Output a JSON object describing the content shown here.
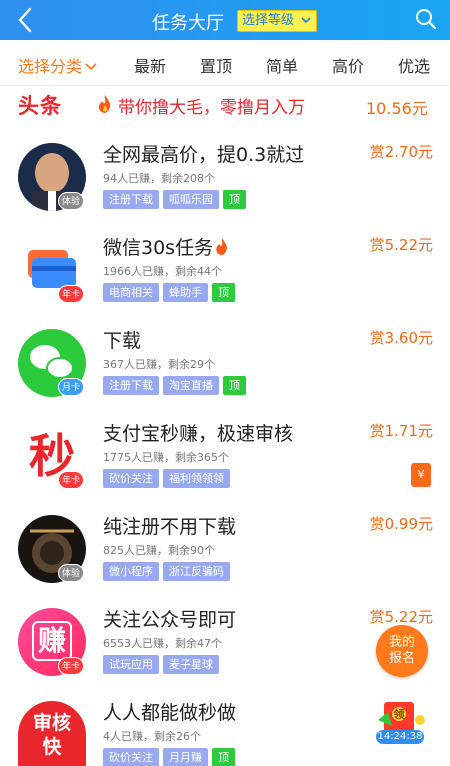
{
  "header": {
    "title": "任务大厅",
    "level_button": "选择等级"
  },
  "filters": {
    "category": "选择分类",
    "items": [
      "最新",
      "置顶",
      "简单",
      "高价",
      "优选"
    ]
  },
  "news": {
    "logo": "头条",
    "text": "带你撸大毛，零撸月入万",
    "amount": "10.56元"
  },
  "tasks": [
    {
      "title": "全网最高价，提0.3就过",
      "meta": "94人已赚，剩余208个",
      "tags": [
        "注册下载",
        "呱呱乐园"
      ],
      "top": "顶",
      "reward": "赏2.70元",
      "badge": "体验",
      "avatar": "portrait"
    },
    {
      "title": "微信30s任务",
      "meta": "1966人已赚，剩余44个",
      "tags": [
        "电商相关",
        "蜂助手"
      ],
      "top": "顶",
      "reward": "赏5.22元",
      "badge": "年卡",
      "avatar": "card"
    },
    {
      "title": "下载",
      "meta": "367人已赚，剩余29个",
      "tags": [
        "注册下载",
        "淘宝直播"
      ],
      "top": "顶",
      "reward": "赏3.60元",
      "badge": "月卡",
      "avatar": "wechat"
    },
    {
      "title": "支付宝秒赚，极速审核",
      "meta": "1775人已赚，剩余365个",
      "tags": [
        "砍价关注",
        "福利领领领"
      ],
      "top": "",
      "reward": "赏1.71元",
      "badge": "年卡",
      "avatar": "秒"
    },
    {
      "title": "纯注册不用下载",
      "meta": "825人已赚，剩余90个",
      "tags": [
        "微小程序",
        "浙江反骗码"
      ],
      "top": "",
      "reward": "赏0.99元",
      "badge": "体验",
      "avatar": "dark"
    },
    {
      "title": "关注公众号即可",
      "meta": "6553人已赚，剩余47个",
      "tags": [
        "试玩应用",
        "麦子星球"
      ],
      "top": "",
      "reward": "赏5.22元",
      "badge": "年卡",
      "avatar": "赚"
    },
    {
      "title": "人人都能做秒做",
      "meta": "4人已赚，剩余26个",
      "tags": [
        "砍价关注",
        "月月赚"
      ],
      "top": "顶",
      "reward": "",
      "badge": "",
      "avatar": "审核快"
    }
  ],
  "float": {
    "red_envelope": "¥",
    "my_report": "我的报名",
    "gift_timer": "14:24:38",
    "gift_label": "领"
  },
  "colors": {
    "header": "#2f8ff0",
    "accent": "#ff7a1a",
    "reward": "#f06a16",
    "news": "#e8262c",
    "tag": "#98a9f0",
    "tag_top": "#2ccb3d"
  }
}
